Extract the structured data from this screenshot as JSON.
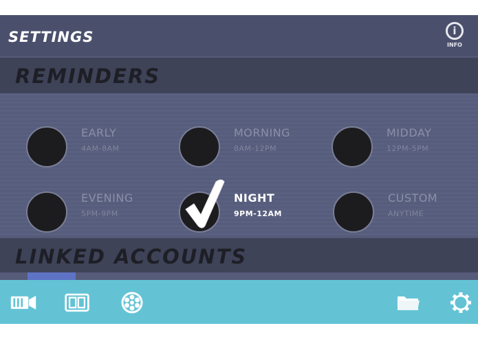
{
  "header": {
    "title": "SETTINGS",
    "info_label": "INFO"
  },
  "reminders": {
    "title": "REMINDERS",
    "options": [
      {
        "name": "EARLY",
        "time": "4AM-8AM",
        "selected": false
      },
      {
        "name": "MORNING",
        "time": "8AM-12PM",
        "selected": false
      },
      {
        "name": "MIDDAY",
        "time": "12PM-5PM",
        "selected": false
      },
      {
        "name": "EVENING",
        "time": "5PM-9PM",
        "selected": false
      },
      {
        "name": "NIGHT",
        "time": "9PM-12AM",
        "selected": true
      },
      {
        "name": "CUSTOM",
        "time": "ANYTIME",
        "selected": false
      }
    ]
  },
  "linked_accounts": {
    "title": "LINKED ACCOUNTS"
  },
  "nav": {
    "icons": [
      "video-camera-icon",
      "phone-layout-icon",
      "film-reel-icon",
      "folder-icon",
      "gear-icon"
    ]
  },
  "colors": {
    "background": "#545a78",
    "section_header": "#3e4358",
    "bottom_bar": "#63c3d5",
    "text_muted": "#8b90a8"
  }
}
